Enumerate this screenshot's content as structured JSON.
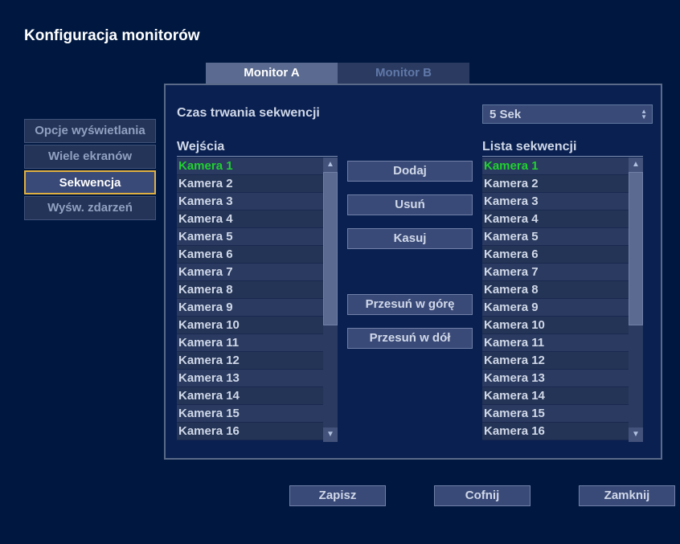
{
  "title": "Konfiguracja monitorów",
  "tabs": {
    "a": "Monitor A",
    "b": "Monitor B",
    "active": "a"
  },
  "side_menu": {
    "items": [
      {
        "label": "Opcje wyświetlania"
      },
      {
        "label": "Wiele ekranów"
      },
      {
        "label": "Sekwencja"
      },
      {
        "label": "Wyśw. zdarzeń"
      }
    ],
    "active_index": 2
  },
  "sequence": {
    "duration_label": "Czas trwania sekwencji",
    "duration_value": "5 Sek"
  },
  "inputs": {
    "header": "Wejścia",
    "items": [
      "Kamera 1",
      "Kamera 2",
      "Kamera 3",
      "Kamera 4",
      "Kamera 5",
      "Kamera 6",
      "Kamera 7",
      "Kamera 8",
      "Kamera 9",
      "Kamera 10",
      "Kamera 11",
      "Kamera 12",
      "Kamera 13",
      "Kamera 14",
      "Kamera 15",
      "Kamera 16"
    ],
    "selected_index": 0
  },
  "seq_list": {
    "header": "Lista sekwencji",
    "items": [
      "Kamera 1",
      "Kamera 2",
      "Kamera 3",
      "Kamera 4",
      "Kamera 5",
      "Kamera 6",
      "Kamera 7",
      "Kamera 8",
      "Kamera 9",
      "Kamera 10",
      "Kamera 11",
      "Kamera 12",
      "Kamera 13",
      "Kamera 14",
      "Kamera 15",
      "Kamera 16"
    ],
    "selected_index": 0
  },
  "buttons": {
    "add": "Dodaj",
    "remove": "Usuń",
    "clear": "Kasuj",
    "move_up": "Przesuń w górę",
    "move_down": "Przesuń w dół"
  },
  "footer": {
    "save": "Zapisz",
    "undo": "Cofnij",
    "close": "Zamknij"
  }
}
